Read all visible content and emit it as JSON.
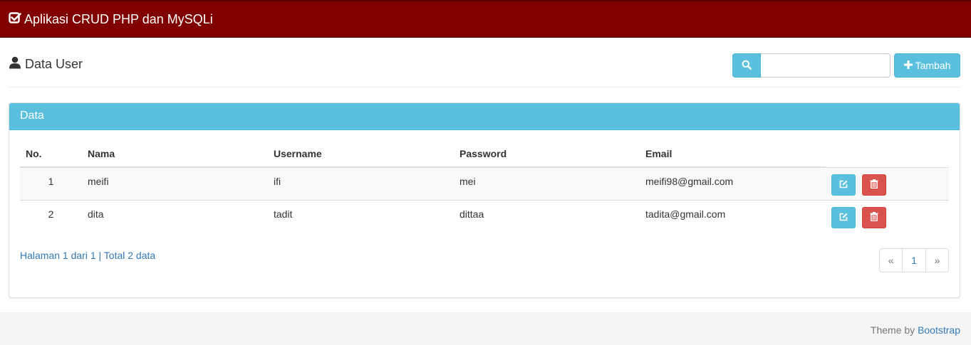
{
  "app": {
    "title": "Aplikasi CRUD PHP dan MySQLi",
    "brand_color": "#800000"
  },
  "header": {
    "title": "Data User",
    "search": {
      "value": "",
      "placeholder": ""
    },
    "add_label": "Tambah",
    "accent_color": "#5bc0de"
  },
  "panel": {
    "title": "Data",
    "table": {
      "columns": [
        "No.",
        "Nama",
        "Username",
        "Password",
        "Email"
      ],
      "rows": [
        {
          "no": "1",
          "nama": "meifi",
          "username": "ifi",
          "password": "mei",
          "email": "meifi98@gmail.com"
        },
        {
          "no": "2",
          "nama": "dita",
          "username": "tadit",
          "password": "dittaa",
          "email": "tadita@gmail.com"
        }
      ]
    },
    "page_info": "Halaman 1 dari 1 | Total 2 data",
    "pagination": {
      "prev": "«",
      "current": "1",
      "next": "»"
    }
  },
  "footer": {
    "prefix": "Theme by",
    "link": "Bootstrap"
  },
  "icons": {
    "brand": "check-square-icon",
    "title": "user-icon",
    "search": "search-icon",
    "add": "plus-icon",
    "edit": "edit-icon",
    "delete": "trash-icon"
  }
}
